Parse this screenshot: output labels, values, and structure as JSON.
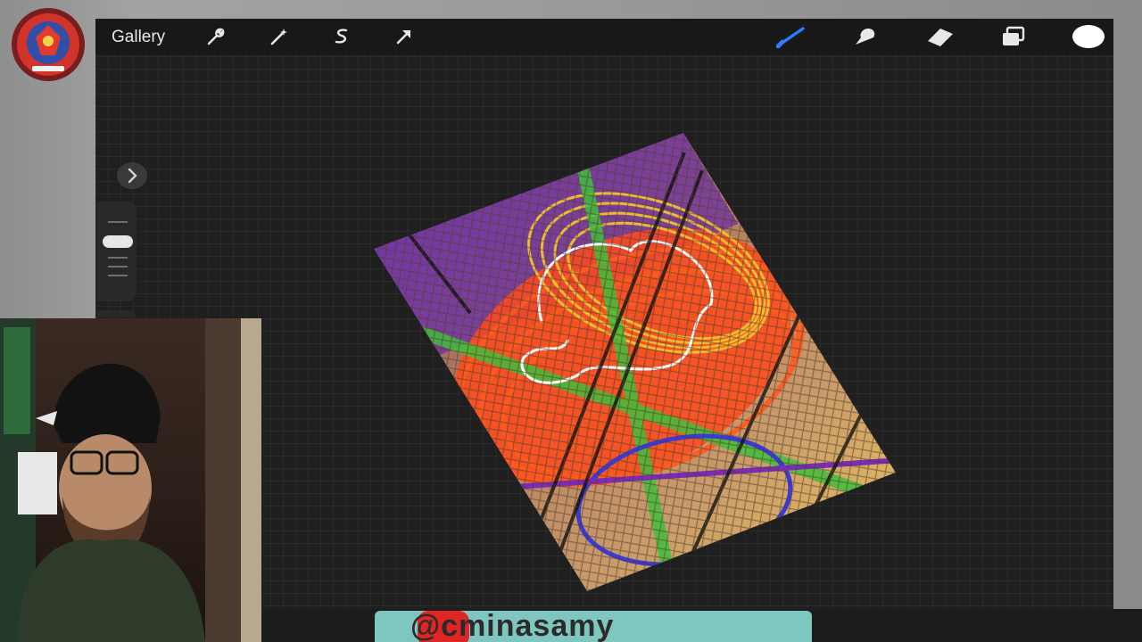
{
  "toolbar": {
    "gallery_label": "Gallery",
    "icons": [
      "wrench-icon",
      "magic-wand-icon",
      "selection-s-icon",
      "transform-arrow-icon",
      "brush-icon",
      "smudge-icon",
      "eraser-icon",
      "layers-icon"
    ],
    "active_tool_color": "#2f7bff",
    "current_color": "#ffffff"
  },
  "sidebar": {
    "toggle_icon": "chevron-right-icon"
  },
  "overlay": {
    "stream_handle": "@cminasamy"
  },
  "colors": {
    "canvas_bg": "#1f1f1f",
    "art_purple": "#6b2fa8",
    "art_orange": "#ff4a1a",
    "art_yellow": "#f2c230",
    "art_green": "#3fbf3a",
    "art_blue": "#3a3ad6"
  }
}
